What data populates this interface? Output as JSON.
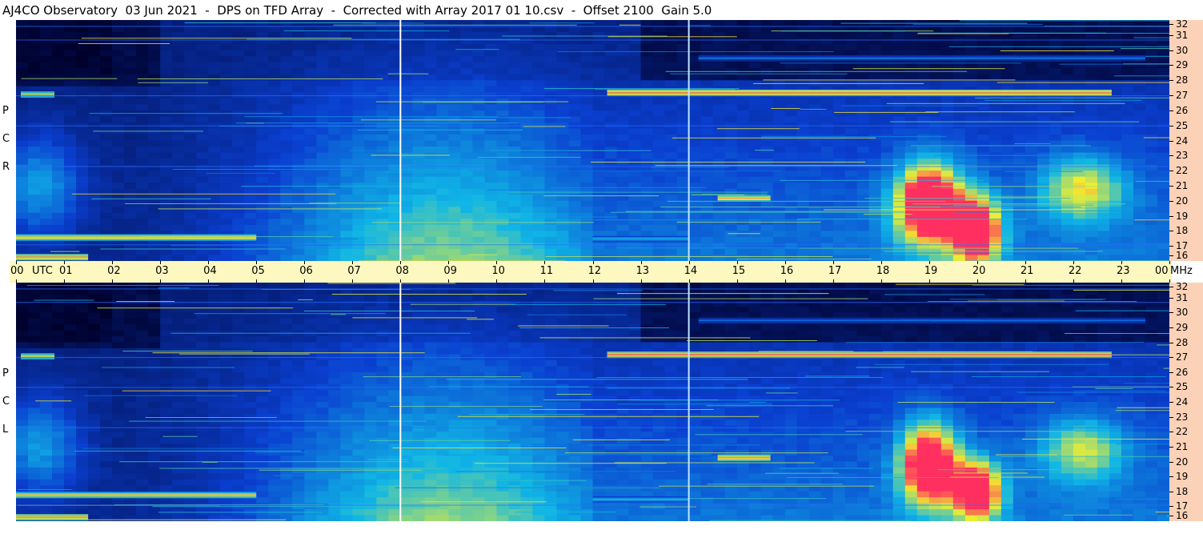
{
  "title": "AJ4CO Observatory  03 Jun 2021  -  DPS on TFD Array  -  Corrected with Array 2017 01 10.csv  -  Offset 2100  Gain 5.0",
  "panels": [
    {
      "id": "rcp",
      "letters": [
        "R",
        "C",
        "P"
      ]
    },
    {
      "id": "lcp",
      "letters": [
        "L",
        "C",
        "P"
      ]
    }
  ],
  "chart_data": {
    "type": "heatmap",
    "title": "AJ4CO Observatory  03 Jun 2021  -  DPS on TFD Array  -  Corrected with Array 2017 01 10.csv  -  Offset 2100  Gain 5.0",
    "x_axis": {
      "unit_label": "UTC",
      "range": [
        0,
        24
      ],
      "tick_labels": [
        "00",
        "01",
        "02",
        "03",
        "04",
        "05",
        "06",
        "07",
        "08",
        "09",
        "10",
        "11",
        "12",
        "13",
        "14",
        "15",
        "16",
        "17",
        "18",
        "19",
        "20",
        "21",
        "22",
        "23",
        "00"
      ]
    },
    "y_axis": {
      "unit_label": "MHz",
      "range": [
        16,
        32
      ],
      "tick_labels": [
        "16",
        "17",
        "18",
        "19",
        "20",
        "21",
        "22",
        "23",
        "24",
        "25",
        "26",
        "27",
        "28",
        "29",
        "30",
        "31",
        "32"
      ]
    },
    "time_markers_utc": [
      8,
      14
    ],
    "series": [
      {
        "name": "R C P",
        "bands_mhz": [
          {
            "f": 27.2,
            "t0": 12.3,
            "t1": 22.8,
            "intensity": 0.95
          },
          {
            "f": 27.1,
            "t0": 0.1,
            "t1": 0.8,
            "intensity": 0.8
          },
          {
            "f": 17.6,
            "t0": 0.0,
            "t1": 5.0,
            "intensity": 0.85
          },
          {
            "f": 16.3,
            "t0": 0.0,
            "t1": 1.5,
            "intensity": 0.9
          },
          {
            "f": 17.5,
            "t0": 12.0,
            "t1": 14.0,
            "intensity": 0.6
          },
          {
            "f": 29.5,
            "t0": 14.2,
            "t1": 23.5,
            "intensity": 0.45
          },
          {
            "f": 20.2,
            "t0": 14.6,
            "t1": 15.7,
            "intensity": 0.9
          }
        ],
        "hotspots": [
          {
            "t": 19.0,
            "f": 19.8,
            "st": 0.7,
            "sf": 2.8,
            "intensity": 0.9
          },
          {
            "t": 20.0,
            "f": 18.0,
            "st": 0.5,
            "sf": 2.2,
            "intensity": 0.85
          },
          {
            "t": 22.2,
            "f": 20.8,
            "st": 0.9,
            "sf": 2.2,
            "intensity": 0.45
          },
          {
            "t": 0.5,
            "f": 21.0,
            "st": 0.9,
            "sf": 3.5,
            "intensity": 0.35
          }
        ]
      },
      {
        "name": "L C P",
        "bands_mhz": [
          {
            "f": 27.2,
            "t0": 12.3,
            "t1": 22.8,
            "intensity": 0.95
          },
          {
            "f": 27.1,
            "t0": 0.1,
            "t1": 0.8,
            "intensity": 0.8
          },
          {
            "f": 17.8,
            "t0": 0.0,
            "t1": 5.0,
            "intensity": 0.85
          },
          {
            "f": 16.3,
            "t0": 0.0,
            "t1": 1.5,
            "intensity": 0.9
          },
          {
            "f": 17.5,
            "t0": 12.0,
            "t1": 14.0,
            "intensity": 0.6
          },
          {
            "f": 29.5,
            "t0": 14.2,
            "t1": 23.5,
            "intensity": 0.45
          },
          {
            "f": 20.3,
            "t0": 14.6,
            "t1": 15.7,
            "intensity": 0.9
          }
        ],
        "hotspots": [
          {
            "t": 19.0,
            "f": 19.8,
            "st": 0.6,
            "sf": 2.8,
            "intensity": 0.85
          },
          {
            "t": 20.0,
            "f": 18.0,
            "st": 0.5,
            "sf": 2.0,
            "intensity": 0.8
          },
          {
            "t": 22.2,
            "f": 20.8,
            "st": 0.9,
            "sf": 2.2,
            "intensity": 0.4
          },
          {
            "t": 0.5,
            "f": 21.0,
            "st": 0.9,
            "sf": 3.5,
            "intensity": 0.35
          }
        ]
      }
    ],
    "colors": {
      "background_noise": "#00002a",
      "low": "#0a3fd0",
      "mid": "#10b6e6",
      "high": "#f0ee30",
      "peak": "#ff3060"
    },
    "legend": "none",
    "grid": false
  }
}
